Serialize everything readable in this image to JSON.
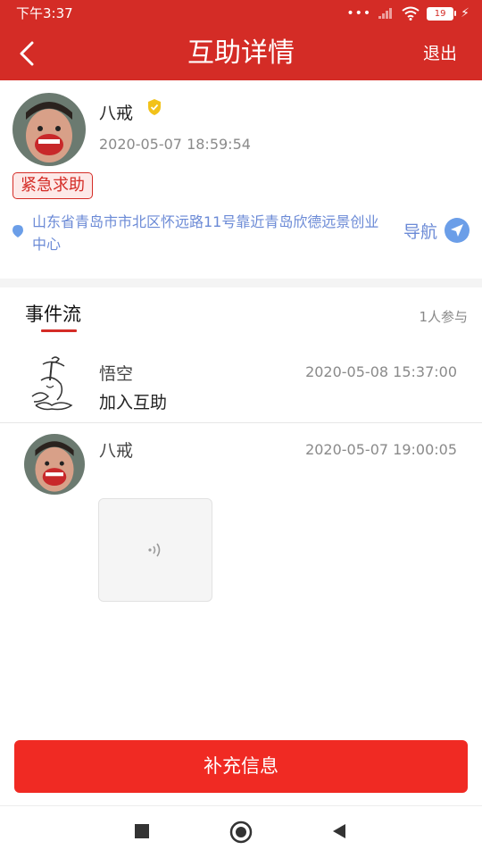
{
  "status_bar": {
    "time": "下午3:37",
    "battery": "19"
  },
  "app_bar": {
    "title": "互助详情",
    "exit_label": "退出"
  },
  "profile": {
    "name": "八戒",
    "timestamp": "2020-05-07 18:59:54",
    "badge": "紧急求助",
    "address": "山东省青岛市市北区怀远路11号靠近青岛欣德远景创业中心",
    "nav_label": "导航"
  },
  "event_flow": {
    "tab_label": "事件流",
    "participants": "1人参与",
    "events": [
      {
        "name": "悟空",
        "time": "2020-05-08 15:37:00",
        "text": "加入互助"
      },
      {
        "name": "八戒",
        "time": "2020-05-07 19:00:05"
      }
    ]
  },
  "bottom_action": {
    "label": "补充信息"
  },
  "colors": {
    "primary": "#d42c26",
    "button": "#f02a23",
    "link": "#6b8ad6"
  }
}
